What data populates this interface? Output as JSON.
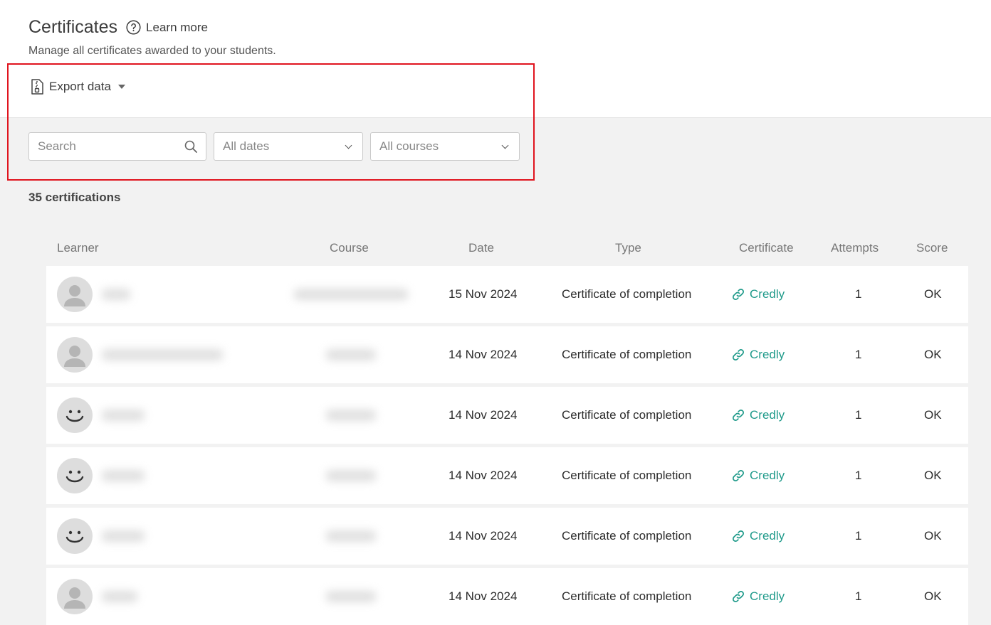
{
  "header": {
    "title": "Certificates",
    "learn_more": "Learn more",
    "subtitle": "Manage all certificates awarded to your students.",
    "export_label": "Export data"
  },
  "filters": {
    "search_placeholder": "Search",
    "dates_value": "All dates",
    "courses_value": "All courses"
  },
  "count_text": "35 certifications",
  "table": {
    "columns": [
      "Learner",
      "Course",
      "Date",
      "Type",
      "Certificate",
      "Attempts",
      "Score"
    ],
    "rows": [
      {
        "avatar": "person-icon",
        "date": "15 Nov 2024",
        "type": "Certificate of completion",
        "certificate": "Credly",
        "attempts": "1",
        "score": "OK"
      },
      {
        "avatar": "person-icon",
        "date": "14 Nov 2024",
        "type": "Certificate of completion",
        "certificate": "Credly",
        "attempts": "1",
        "score": "OK"
      },
      {
        "avatar": "smiley-icon",
        "date": "14 Nov 2024",
        "type": "Certificate of completion",
        "certificate": "Credly",
        "attempts": "1",
        "score": "OK"
      },
      {
        "avatar": "smiley-icon",
        "date": "14 Nov 2024",
        "type": "Certificate of completion",
        "certificate": "Credly",
        "attempts": "1",
        "score": "OK"
      },
      {
        "avatar": "smiley-icon",
        "date": "14 Nov 2024",
        "type": "Certificate of completion",
        "certificate": "Credly",
        "attempts": "1",
        "score": "OK"
      },
      {
        "avatar": "person-icon",
        "date": "14 Nov 2024",
        "type": "Certificate of completion",
        "certificate": "Credly",
        "attempts": "1",
        "score": "OK"
      }
    ]
  },
  "colors": {
    "link": "#1f9a8a",
    "highlight": "#e0141e"
  }
}
